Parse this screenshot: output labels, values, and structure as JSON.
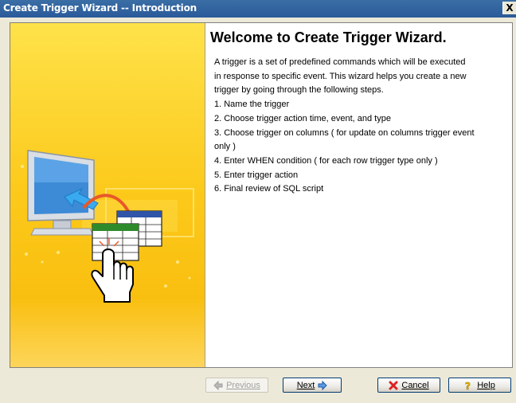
{
  "window": {
    "title": "Create Trigger Wizard -- Introduction",
    "close_label": "X"
  },
  "main": {
    "heading": "Welcome to Create Trigger Wizard.",
    "lines": [
      "A trigger is a set of predefined commands which will be executed",
      "in response to specific event. This wizard helps you create a new",
      "trigger by going through the following steps.",
      "1. Name the trigger",
      "2. Choose trigger action time, event, and type",
      "3. Choose trigger on columns ( for update on columns trigger event",
      "only )",
      "4. Enter WHEN condition ( for each row trigger type only )",
      "5. Enter trigger action",
      "6. Final review of SQL script"
    ]
  },
  "buttons": {
    "previous": "Previous",
    "next": "Next",
    "cancel": "Cancel",
    "help": "Help"
  },
  "colors": {
    "titlebar": "#2a5a9a",
    "panel_yellow": "#fcc91a"
  }
}
